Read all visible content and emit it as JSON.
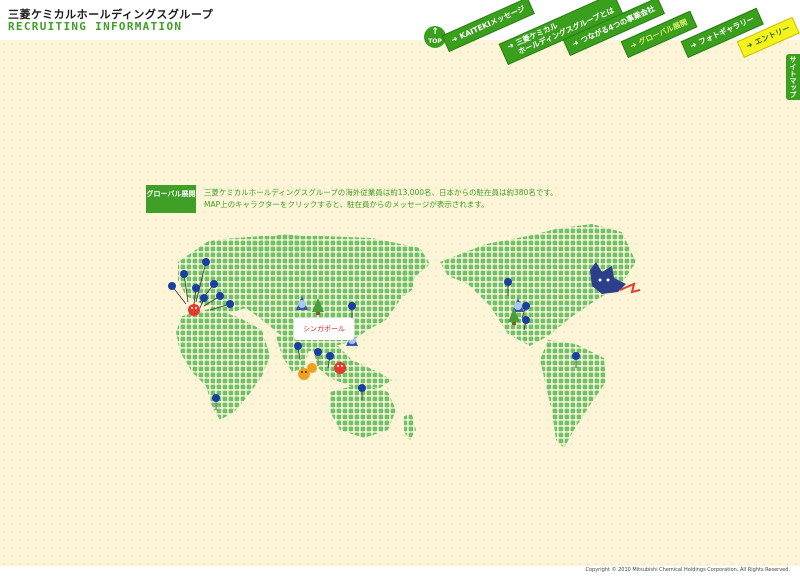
{
  "header": {
    "logo_jp": "三菱ケミカルホールディングスグループ",
    "logo_en": "RECRUITING INFORMATION"
  },
  "nav": {
    "top_label": "TOP",
    "tabs": [
      {
        "label": "KAITEKIメッセージ"
      },
      {
        "label_line1": "三菱ケミカル",
        "label_line2": "ホールディングスグループとは"
      },
      {
        "label": "つながる4つの事業会社"
      },
      {
        "label": "グローバル展開"
      },
      {
        "label": "フォトギャラリー"
      },
      {
        "label": "エントリー"
      }
    ],
    "sitemap_label": "サイトマップ"
  },
  "section": {
    "label": "グローバル展開",
    "description_line1": "三菱ケミカルホールディングスグループの海外従業員は約13,000名、日本からの駐在員は約380名です。",
    "description_line2": "MAP上のキャラクターをクリックすると、駐在員からのメッセージが表示されます。"
  },
  "map": {
    "callout_label": "シンガポール",
    "pin_color": "#1a3fa0",
    "land_color": "#6ec36a",
    "mascot_colors": {
      "red": "#e23b2e",
      "blue": "#3a57a8",
      "green": "#4a9e3a",
      "orange": "#f0a020"
    }
  },
  "footer": {
    "copyright": "Copyright © 2010 Mitsubishi Chemical Holdings Corporation. All Rights Reserved."
  },
  "colors": {
    "brand_green": "#3a9f1d",
    "entry_yellow": "#f6f21e",
    "background": "#fdf5d8"
  }
}
